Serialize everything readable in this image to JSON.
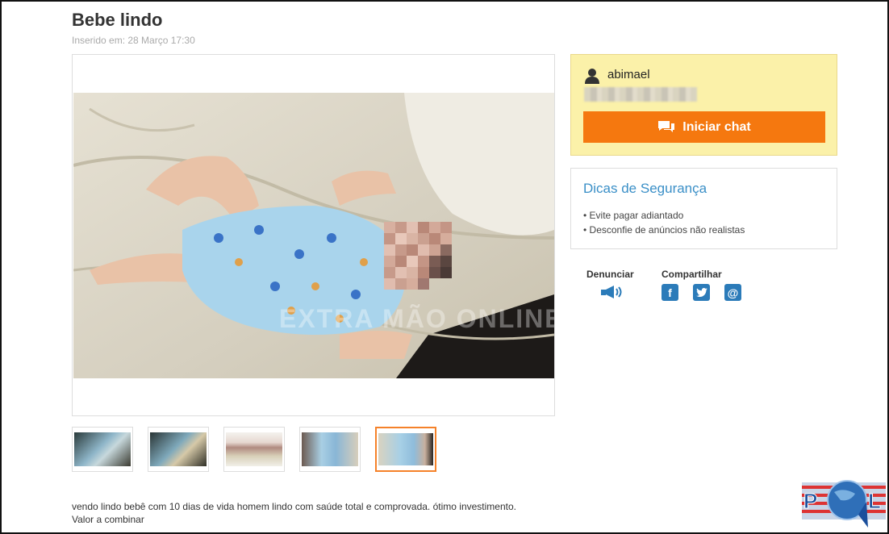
{
  "listing": {
    "title": "Bebe lindo",
    "date": "Inserido em: 28 Março 17:30",
    "watermark": "EXTRA MÃO ONLINE",
    "description_line1": "vendo lindo bebê com 10 dias de vida homem lindo com saúde total e comprovada. ótimo investimento.",
    "description_line2": "Valor a combinar"
  },
  "seller": {
    "name": "abimael",
    "chat_button_label": "Iniciar chat"
  },
  "safety_tips": {
    "title": "Dicas de Segurança",
    "items": [
      "Evite pagar adiantado",
      "Desconfie de anúncios não realistas"
    ]
  },
  "actions": {
    "report_label": "Denunciar",
    "share_label": "Compartilhar",
    "share_icons": [
      "facebook-icon",
      "twitter-icon",
      "email-icon"
    ]
  },
  "thumbnails": {
    "count": 5,
    "active_index": 4
  },
  "colors": {
    "accent_orange": "#f5780f",
    "seller_box_bg": "#fbf1a9",
    "link_blue": "#3a8fc7",
    "social_blue": "#2b7bb9"
  }
}
